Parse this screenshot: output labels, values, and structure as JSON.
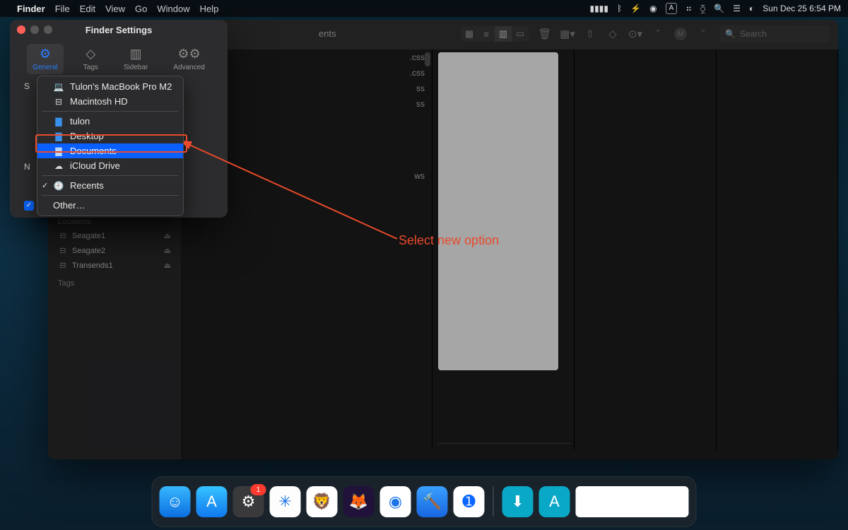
{
  "menubar": {
    "app": "Finder",
    "items": [
      "File",
      "Edit",
      "View",
      "Go",
      "Window",
      "Help"
    ],
    "status": {
      "input": "A",
      "datetime": "Sun Dec 25  6:54 PM"
    }
  },
  "finder": {
    "title": "ents",
    "search_placeholder": "Search",
    "sidebar": {
      "locations_label": "Locations",
      "tags_label": "Tags",
      "items": [
        {
          "label": "Seagate1"
        },
        {
          "label": "Seagate2"
        },
        {
          "label": "Transends1"
        }
      ]
    },
    "col1_files": [
      ".css",
      ".css",
      "ss",
      "ss",
      "ws"
    ]
  },
  "settings": {
    "title": "Finder Settings",
    "tabs": [
      {
        "label": "General",
        "active": true
      },
      {
        "label": "Tags",
        "active": false
      },
      {
        "label": "Sidebar",
        "active": false
      },
      {
        "label": "Advanced",
        "active": false
      }
    ],
    "section_label_1": "S",
    "section_label_2": "N"
  },
  "dropdown": {
    "options": [
      {
        "label": "Tulon's MacBook Pro M2",
        "icon": "laptop",
        "highlight": false,
        "checked": false
      },
      {
        "label": "Macintosh HD",
        "icon": "hdd",
        "highlight": false,
        "checked": false
      },
      {
        "sep": true
      },
      {
        "label": "tulon",
        "icon": "folder",
        "highlight": false,
        "checked": false
      },
      {
        "label": "Desktop",
        "icon": "folder",
        "highlight": false,
        "checked": false
      },
      {
        "label": "Documents",
        "icon": "folder",
        "highlight": true,
        "checked": false
      },
      {
        "label": "iCloud Drive",
        "icon": "cloud",
        "highlight": false,
        "checked": false
      },
      {
        "sep": true
      },
      {
        "label": "Recents",
        "icon": "clock",
        "highlight": false,
        "checked": true
      },
      {
        "sep": true
      },
      {
        "label": "Other…",
        "icon": "",
        "highlight": false,
        "checked": false
      }
    ]
  },
  "annotation": {
    "text": "Select new option",
    "color": "#e84a2a"
  },
  "dock": {
    "apps": [
      {
        "name": "finder",
        "bg": "linear-gradient(#38b7ff,#0b6fe0)",
        "glyph": "☺"
      },
      {
        "name": "appstore",
        "bg": "linear-gradient(#35c3ff,#1178ef)",
        "glyph": "A"
      },
      {
        "name": "settings",
        "bg": "#3a3a3c",
        "glyph": "⚙",
        "badge": "1"
      },
      {
        "name": "safari",
        "bg": "#fdfdfd",
        "glyph": "✳",
        "fg": "#1771e6"
      },
      {
        "name": "brave",
        "bg": "#fff",
        "glyph": "🦁",
        "fg": "#f0502a"
      },
      {
        "name": "firefox",
        "bg": "#20123a",
        "glyph": "🦊"
      },
      {
        "name": "chrome",
        "bg": "#fff",
        "glyph": "◉",
        "fg": "#1a73e8"
      },
      {
        "name": "xcode",
        "bg": "linear-gradient(#3aa0ff,#1766e0)",
        "glyph": "🔨"
      },
      {
        "name": "1password",
        "bg": "#fff",
        "glyph": "➊",
        "fg": "#0a66ff"
      }
    ],
    "recent": [
      {
        "name": "downloads",
        "bg": "#0aa8c7",
        "glyph": "⬇"
      },
      {
        "name": "apps-folder",
        "bg": "#0aa8c7",
        "glyph": "A"
      }
    ]
  }
}
